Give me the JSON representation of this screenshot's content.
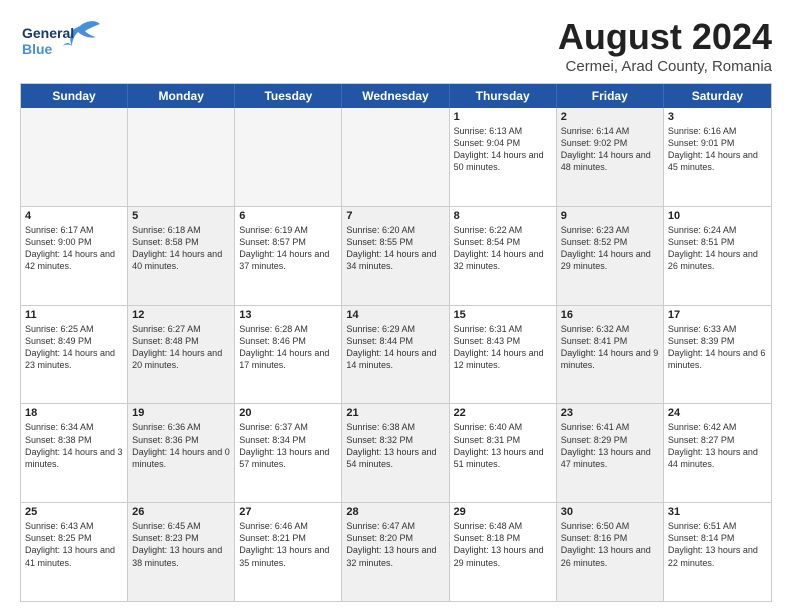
{
  "header": {
    "logo_line1": "General",
    "logo_line2": "Blue",
    "month_title": "August 2024",
    "location": "Cermei, Arad County, Romania"
  },
  "days_of_week": [
    "Sunday",
    "Monday",
    "Tuesday",
    "Wednesday",
    "Thursday",
    "Friday",
    "Saturday"
  ],
  "rows": [
    [
      {
        "day": "",
        "text": "",
        "empty": true
      },
      {
        "day": "",
        "text": "",
        "empty": true
      },
      {
        "day": "",
        "text": "",
        "empty": true
      },
      {
        "day": "",
        "text": "",
        "empty": true
      },
      {
        "day": "1",
        "text": "Sunrise: 6:13 AM\nSunset: 9:04 PM\nDaylight: 14 hours and 50 minutes."
      },
      {
        "day": "2",
        "text": "Sunrise: 6:14 AM\nSunset: 9:02 PM\nDaylight: 14 hours and 48 minutes.",
        "shaded": true
      },
      {
        "day": "3",
        "text": "Sunrise: 6:16 AM\nSunset: 9:01 PM\nDaylight: 14 hours and 45 minutes."
      }
    ],
    [
      {
        "day": "4",
        "text": "Sunrise: 6:17 AM\nSunset: 9:00 PM\nDaylight: 14 hours and 42 minutes."
      },
      {
        "day": "5",
        "text": "Sunrise: 6:18 AM\nSunset: 8:58 PM\nDaylight: 14 hours and 40 minutes.",
        "shaded": true
      },
      {
        "day": "6",
        "text": "Sunrise: 6:19 AM\nSunset: 8:57 PM\nDaylight: 14 hours and 37 minutes."
      },
      {
        "day": "7",
        "text": "Sunrise: 6:20 AM\nSunset: 8:55 PM\nDaylight: 14 hours and 34 minutes.",
        "shaded": true
      },
      {
        "day": "8",
        "text": "Sunrise: 6:22 AM\nSunset: 8:54 PM\nDaylight: 14 hours and 32 minutes."
      },
      {
        "day": "9",
        "text": "Sunrise: 6:23 AM\nSunset: 8:52 PM\nDaylight: 14 hours and 29 minutes.",
        "shaded": true
      },
      {
        "day": "10",
        "text": "Sunrise: 6:24 AM\nSunset: 8:51 PM\nDaylight: 14 hours and 26 minutes."
      }
    ],
    [
      {
        "day": "11",
        "text": "Sunrise: 6:25 AM\nSunset: 8:49 PM\nDaylight: 14 hours and 23 minutes."
      },
      {
        "day": "12",
        "text": "Sunrise: 6:27 AM\nSunset: 8:48 PM\nDaylight: 14 hours and 20 minutes.",
        "shaded": true
      },
      {
        "day": "13",
        "text": "Sunrise: 6:28 AM\nSunset: 8:46 PM\nDaylight: 14 hours and 17 minutes."
      },
      {
        "day": "14",
        "text": "Sunrise: 6:29 AM\nSunset: 8:44 PM\nDaylight: 14 hours and 14 minutes.",
        "shaded": true
      },
      {
        "day": "15",
        "text": "Sunrise: 6:31 AM\nSunset: 8:43 PM\nDaylight: 14 hours and 12 minutes."
      },
      {
        "day": "16",
        "text": "Sunrise: 6:32 AM\nSunset: 8:41 PM\nDaylight: 14 hours and 9 minutes.",
        "shaded": true
      },
      {
        "day": "17",
        "text": "Sunrise: 6:33 AM\nSunset: 8:39 PM\nDaylight: 14 hours and 6 minutes."
      }
    ],
    [
      {
        "day": "18",
        "text": "Sunrise: 6:34 AM\nSunset: 8:38 PM\nDaylight: 14 hours and 3 minutes."
      },
      {
        "day": "19",
        "text": "Sunrise: 6:36 AM\nSunset: 8:36 PM\nDaylight: 14 hours and 0 minutes.",
        "shaded": true
      },
      {
        "day": "20",
        "text": "Sunrise: 6:37 AM\nSunset: 8:34 PM\nDaylight: 13 hours and 57 minutes."
      },
      {
        "day": "21",
        "text": "Sunrise: 6:38 AM\nSunset: 8:32 PM\nDaylight: 13 hours and 54 minutes.",
        "shaded": true
      },
      {
        "day": "22",
        "text": "Sunrise: 6:40 AM\nSunset: 8:31 PM\nDaylight: 13 hours and 51 minutes."
      },
      {
        "day": "23",
        "text": "Sunrise: 6:41 AM\nSunset: 8:29 PM\nDaylight: 13 hours and 47 minutes.",
        "shaded": true
      },
      {
        "day": "24",
        "text": "Sunrise: 6:42 AM\nSunset: 8:27 PM\nDaylight: 13 hours and 44 minutes."
      }
    ],
    [
      {
        "day": "25",
        "text": "Sunrise: 6:43 AM\nSunset: 8:25 PM\nDaylight: 13 hours and 41 minutes."
      },
      {
        "day": "26",
        "text": "Sunrise: 6:45 AM\nSunset: 8:23 PM\nDaylight: 13 hours and 38 minutes.",
        "shaded": true
      },
      {
        "day": "27",
        "text": "Sunrise: 6:46 AM\nSunset: 8:21 PM\nDaylight: 13 hours and 35 minutes."
      },
      {
        "day": "28",
        "text": "Sunrise: 6:47 AM\nSunset: 8:20 PM\nDaylight: 13 hours and 32 minutes.",
        "shaded": true
      },
      {
        "day": "29",
        "text": "Sunrise: 6:48 AM\nSunset: 8:18 PM\nDaylight: 13 hours and 29 minutes."
      },
      {
        "day": "30",
        "text": "Sunrise: 6:50 AM\nSunset: 8:16 PM\nDaylight: 13 hours and 26 minutes.",
        "shaded": true
      },
      {
        "day": "31",
        "text": "Sunrise: 6:51 AM\nSunset: 8:14 PM\nDaylight: 13 hours and 22 minutes."
      }
    ]
  ]
}
